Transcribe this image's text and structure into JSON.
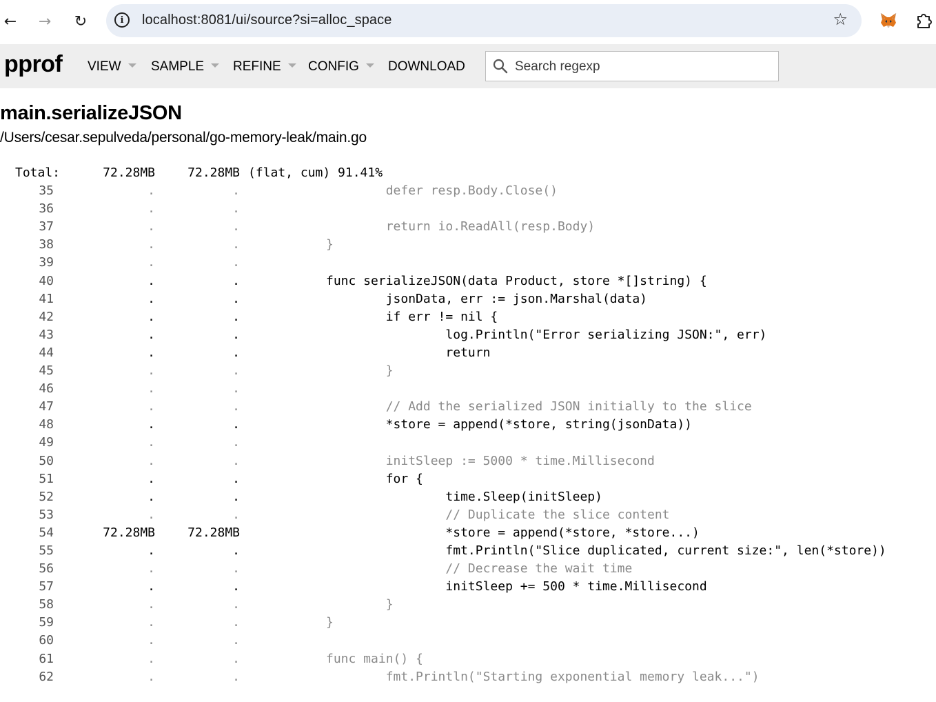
{
  "browser": {
    "back_icon": "arrow-left-icon",
    "forward_icon": "arrow-right-icon",
    "reload_icon": "reload-icon",
    "url": "localhost:8081/ui/source?si=alloc_space",
    "site_info_icon": "info-icon",
    "bookmark_icon": "star-icon",
    "extensions": [
      "metamask-fox-icon",
      "puzzle-icon"
    ]
  },
  "header": {
    "logo": "pprof",
    "menus": [
      {
        "label": "VIEW",
        "dropdown": true
      },
      {
        "label": "SAMPLE",
        "dropdown": true
      },
      {
        "label": "REFINE",
        "dropdown": true
      },
      {
        "label": "CONFIG",
        "dropdown": true
      },
      {
        "label": "DOWNLOAD",
        "dropdown": false
      }
    ],
    "search": {
      "placeholder": "Search regexp",
      "value": ""
    }
  },
  "source": {
    "function_name": "main.serializeJSON",
    "file_path": "/Users/cesar.sepulveda/personal/go-memory-leak/main.go",
    "total": {
      "label": "Total:",
      "flat": "72.28MB",
      "cum": "72.28MB",
      "rest": "(flat, cum) 91.41%"
    },
    "lines": [
      {
        "num": "35",
        "flat": ".",
        "cum": ".",
        "code": "        defer resp.Body.Close()",
        "dim": true
      },
      {
        "num": "36",
        "flat": ".",
        "cum": ".",
        "code": "",
        "dim": true
      },
      {
        "num": "37",
        "flat": ".",
        "cum": ".",
        "code": "        return io.ReadAll(resp.Body)",
        "dim": true
      },
      {
        "num": "38",
        "flat": ".",
        "cum": ".",
        "code": "}",
        "dim": true
      },
      {
        "num": "39",
        "flat": ".",
        "cum": ".",
        "code": "",
        "dim": true
      },
      {
        "num": "40",
        "flat": ".",
        "cum": ".",
        "code": "func serializeJSON(data Product, store *[]string) {",
        "dim": false
      },
      {
        "num": "41",
        "flat": ".",
        "cum": ".",
        "code": "        jsonData, err := json.Marshal(data)",
        "dim": false
      },
      {
        "num": "42",
        "flat": ".",
        "cum": ".",
        "code": "        if err != nil {",
        "dim": false
      },
      {
        "num": "43",
        "flat": ".",
        "cum": ".",
        "code": "                log.Println(\"Error serializing JSON:\", err)",
        "dim": false
      },
      {
        "num": "44",
        "flat": ".",
        "cum": ".",
        "code": "                return",
        "dim": false
      },
      {
        "num": "45",
        "flat": ".",
        "cum": ".",
        "code": "        }",
        "dim": true
      },
      {
        "num": "46",
        "flat": ".",
        "cum": ".",
        "code": "",
        "dim": true
      },
      {
        "num": "47",
        "flat": ".",
        "cum": ".",
        "code": "        // Add the serialized JSON initially to the slice",
        "dim": true
      },
      {
        "num": "48",
        "flat": ".",
        "cum": ".",
        "code": "        *store = append(*store, string(jsonData))",
        "dim": false
      },
      {
        "num": "49",
        "flat": ".",
        "cum": ".",
        "code": "",
        "dim": true
      },
      {
        "num": "50",
        "flat": ".",
        "cum": ".",
        "code": "        initSleep := 5000 * time.Millisecond",
        "dim": true
      },
      {
        "num": "51",
        "flat": ".",
        "cum": ".",
        "code": "        for {",
        "dim": false
      },
      {
        "num": "52",
        "flat": ".",
        "cum": ".",
        "code": "                time.Sleep(initSleep)",
        "dim": false
      },
      {
        "num": "53",
        "flat": ".",
        "cum": ".",
        "code": "                // Duplicate the slice content",
        "dim": true
      },
      {
        "num": "54",
        "flat": "72.28MB",
        "cum": "72.28MB",
        "code": "                *store = append(*store, *store...)",
        "dim": false
      },
      {
        "num": "55",
        "flat": ".",
        "cum": ".",
        "code": "                fmt.Println(\"Slice duplicated, current size:\", len(*store))",
        "dim": false
      },
      {
        "num": "56",
        "flat": ".",
        "cum": ".",
        "code": "                // Decrease the wait time",
        "dim": true
      },
      {
        "num": "57",
        "flat": ".",
        "cum": ".",
        "code": "                initSleep += 500 * time.Millisecond",
        "dim": false
      },
      {
        "num": "58",
        "flat": ".",
        "cum": ".",
        "code": "        }",
        "dim": true
      },
      {
        "num": "59",
        "flat": ".",
        "cum": ".",
        "code": "}",
        "dim": true
      },
      {
        "num": "60",
        "flat": ".",
        "cum": ".",
        "code": "",
        "dim": true
      },
      {
        "num": "61",
        "flat": ".",
        "cum": ".",
        "code": "func main() {",
        "dim": true
      },
      {
        "num": "62",
        "flat": ".",
        "cum": ".",
        "code": "        fmt.Println(\"Starting exponential memory leak...\")",
        "dim": true
      }
    ]
  }
}
